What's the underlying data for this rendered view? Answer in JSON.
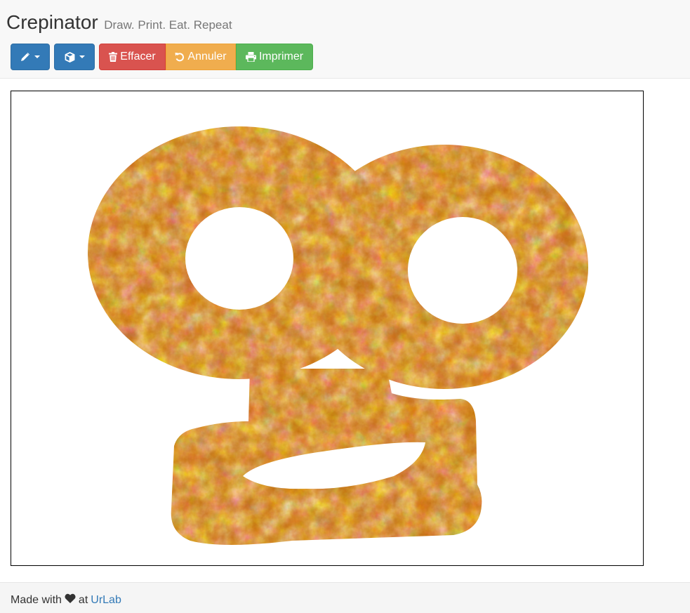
{
  "header": {
    "title": "Crepinator",
    "tagline": "Draw. Print. Eat. Repeat"
  },
  "toolbar": {
    "draw_tool": {
      "icon": "pencil-icon"
    },
    "shape_tool": {
      "icon": "cube-icon"
    },
    "clear_label": "Effacer",
    "undo_label": "Annuler",
    "print_label": "Imprimer"
  },
  "canvas": {
    "drawing": "crepe-face-drawing"
  },
  "footer": {
    "made_with": "Made with",
    "at": "at",
    "link_label": "UrLab"
  },
  "colors": {
    "primary": "#337ab7",
    "danger": "#d9534f",
    "warning": "#f0ad4e",
    "success": "#5cb85c",
    "crepe_light": "#f6c063",
    "crepe_dark": "#8a4500"
  }
}
